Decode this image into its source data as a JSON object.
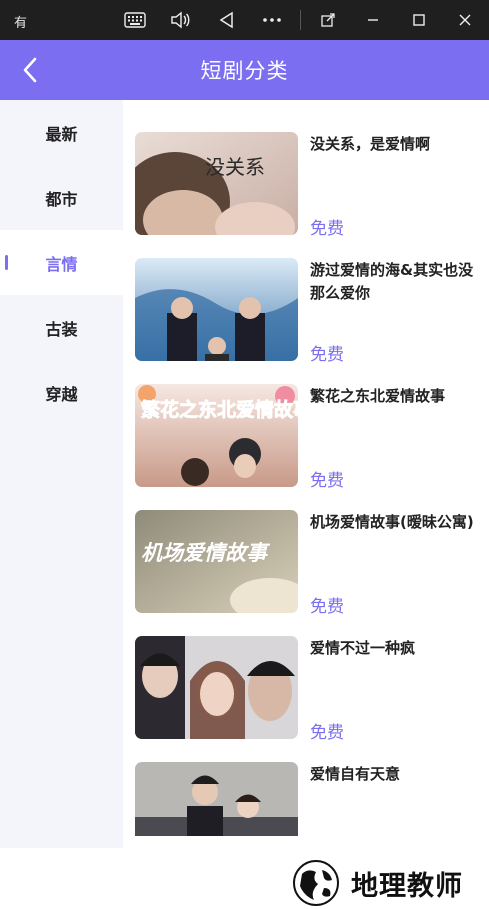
{
  "window": {
    "title": "有",
    "controls": [
      "keyboard-icon",
      "volume-icon",
      "back-triangle-icon",
      "more-icon",
      "restore-icon",
      "minimize-icon",
      "maximize-icon",
      "close-icon"
    ]
  },
  "header": {
    "title": "短剧分类",
    "back_icon": "chevron-left-icon",
    "background": "#7b6ef0"
  },
  "sidebar": {
    "items": [
      {
        "label": "最新"
      },
      {
        "label": "都市"
      },
      {
        "label": "言情",
        "active": true
      },
      {
        "label": "古装"
      },
      {
        "label": "穿越"
      }
    ]
  },
  "dramas": [
    {
      "title": "没关系，是爱情啊",
      "price": "免费",
      "cover_text": "没关系"
    },
    {
      "title": "游过爱情的海&其实也没那么爱你",
      "price": "免费"
    },
    {
      "title": "繁花之东北爱情故事",
      "price": "免费",
      "cover_text": "繁花之东北爱情故事"
    },
    {
      "title": "机场爱情故事(暧昧公寓)",
      "price": "免费",
      "cover_text": "机场爱情故事"
    },
    {
      "title": "爱情不过一种疯",
      "price": "免费"
    },
    {
      "title": "爱情自有天意",
      "price": ""
    }
  ],
  "watermark": {
    "text": "地理教师"
  },
  "colors": {
    "accent": "#7b6ef0",
    "sidebar_bg": "#f4f5fa",
    "titlebar_bg": "#1f1f1f"
  }
}
